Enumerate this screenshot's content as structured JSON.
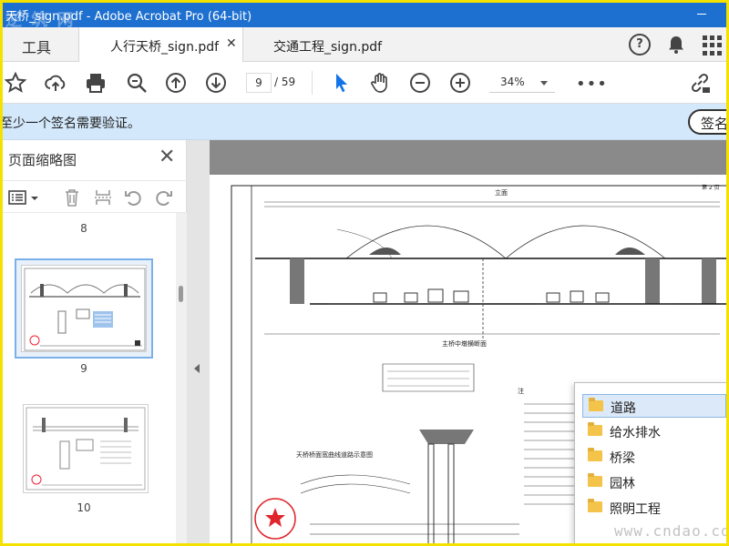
{
  "window": {
    "title": "天桥_sign.pdf - Adobe Acrobat Pro (64-bit)"
  },
  "tabs": {
    "tools_label": "工具",
    "active_tab": "人行天桥_sign.pdf",
    "close_symbol": "✕",
    "second_tab": "交通工程_sign.pdf",
    "help_symbol": "?"
  },
  "toolbar": {
    "current_page": "9",
    "page_total": "/ 59",
    "zoom": "34%",
    "more": "•••"
  },
  "notice": {
    "message": "至少一个签名需要验证。",
    "sign_button": "签名"
  },
  "sidebar": {
    "title": "页面缩略图",
    "close_symbol": "✕",
    "pages": [
      "8",
      "9",
      "10"
    ]
  },
  "context_menu": {
    "items": [
      "道路",
      "给水排水",
      "桥梁",
      "园林",
      "照明工程"
    ],
    "selected_index": 0
  },
  "watermarks": {
    "top": "逆 筑 网",
    "bottom": "www.cndao.com"
  },
  "drawing": {
    "section_title": "立面",
    "sheet_no": "第 2 页",
    "elevation_caption": "主桥中墩横断面",
    "plan_caption": "天桥桥面宽曲线道路示意图",
    "notes_heading": "注"
  },
  "colors": {
    "title_bar": "#1d6fd0",
    "notice_bg": "#d3e8fb",
    "selected_item": "#dce9f8",
    "folder": "#f3c449",
    "frame": "#f5e100"
  }
}
